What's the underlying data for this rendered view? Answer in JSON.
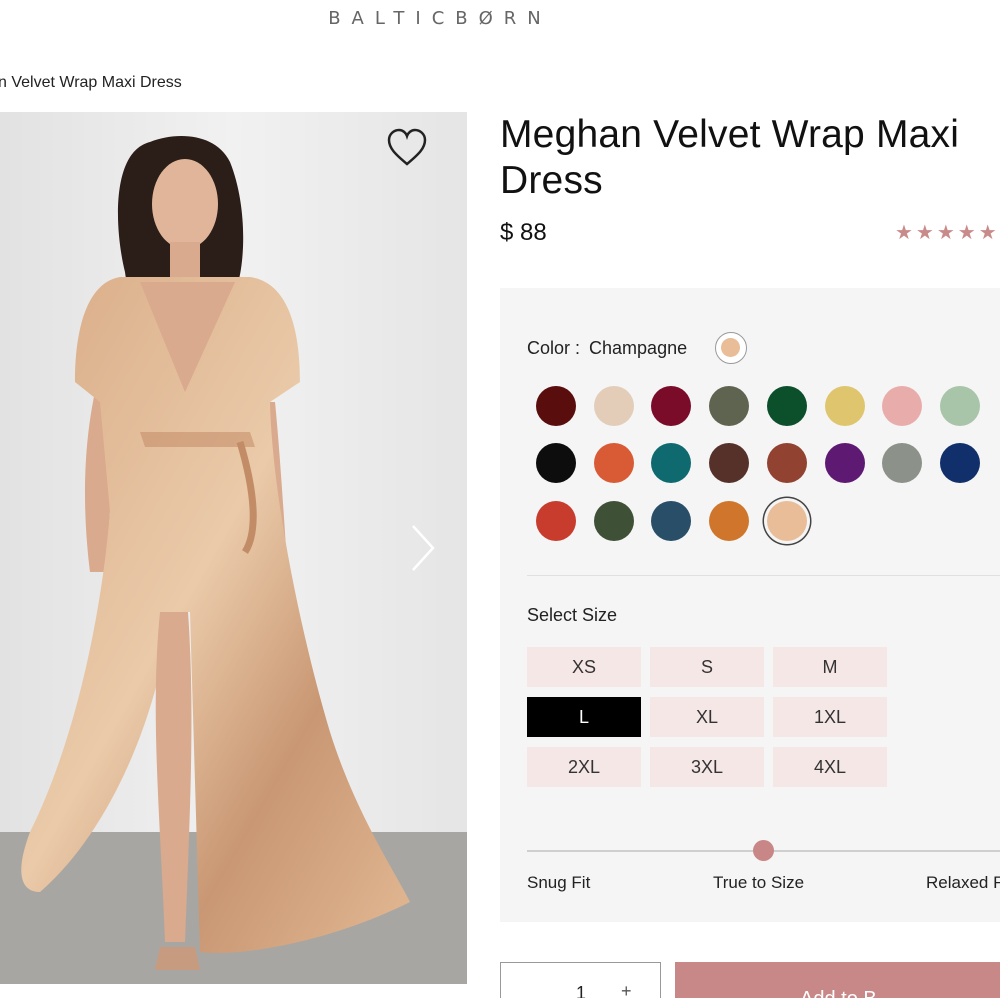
{
  "header": {
    "logo_text": "BALTICBØRN"
  },
  "breadcrumb": {
    "current": "n Velvet Wrap Maxi Dress"
  },
  "product": {
    "title": "Meghan Velvet Wrap Maxi Dress",
    "price": "$ 88",
    "rating_stars": "★★★★★"
  },
  "color": {
    "label": "Color :",
    "selected_name": "Champagne",
    "selected_hex": "#e8bd98",
    "swatches": [
      [
        "#5a0d0d",
        "#e3cdb8",
        "#7a0c2a",
        "#5f6450",
        "#0b4f2b",
        "#e0c56f",
        "#e8adab",
        "#a8c5aa"
      ],
      [
        "#0d0d0d",
        "#d85b35",
        "#0f6a70",
        "#56312a",
        "#914230",
        "#5e1a73",
        "#8c9189",
        "#102f6b"
      ],
      [
        "#c73c2c",
        "#3e5137",
        "#284e68",
        "#cf762c",
        "#e8bd98"
      ]
    ]
  },
  "size": {
    "label": "Select Size",
    "options": [
      "XS",
      "S",
      "M",
      "L",
      "XL",
      "1XL",
      "2XL",
      "3XL",
      "4XL"
    ],
    "selected": "L"
  },
  "fit": {
    "low_label": "Snug Fit",
    "mid_label": "True to Size",
    "high_label": "Relaxed F",
    "level": 0.5
  },
  "cart": {
    "quantity": "1",
    "plus_symbol": "+",
    "add_label": "Add to B"
  },
  "colors": {
    "accent": "#c98888",
    "panel": "#f5f5f5",
    "size_bg": "#f6e7e7"
  },
  "icons": {
    "wishlist": "heart-icon",
    "next": "chevron-right-icon"
  }
}
